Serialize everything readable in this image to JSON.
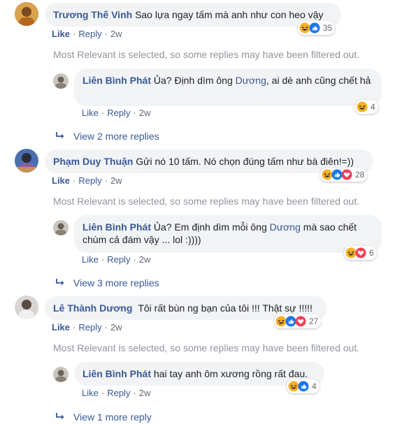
{
  "comments": [
    {
      "author": "Trương Thế Vinh",
      "text": "Sao lựa ngay tấm mà anh như con heo vậy",
      "actions": {
        "like": "Like",
        "reply": "Reply",
        "time": "2w"
      },
      "reaction_count": "35",
      "filter_note": "Most Relevant is selected, so some replies may have been filtered out.",
      "reply": {
        "author": "Liên Bình Phát",
        "text_before": "Ủa? Định dìm ông ",
        "mention": "Dương",
        "text_after": ", ai dè anh cũng chết hả",
        "actions": {
          "like": "Like",
          "reply": "Reply",
          "time": "2w"
        },
        "reaction_count": "4"
      },
      "view_more": "View 2 more replies"
    },
    {
      "author": "Phạm Duy Thuận",
      "text": "Gửi nó 10 tấm. Nó chọn đúng tấm như bà điên!=))",
      "actions": {
        "like": "Like",
        "reply": "Reply",
        "time": "2w"
      },
      "reaction_count": "28",
      "filter_note": "Most Relevant is selected, so some replies may have been filtered out.",
      "reply": {
        "author": "Liên Bình Phát",
        "text_before": "Ủa? Em định dìm mỗi ông ",
        "mention": "Dương",
        "text_after": " mà sao chết chùm cả đám vậy ... lol :))))",
        "actions": {
          "like": "Like",
          "reply": "Reply",
          "time": "2w"
        },
        "reaction_count": "6"
      },
      "view_more": "View 3 more replies"
    },
    {
      "author": "Lê Thành Dương",
      "text": "Tôi rất bùn ng bạn của tôi !!! Thật sự !!!!!",
      "actions": {
        "like": "Like",
        "reply": "Reply",
        "time": "2w"
      },
      "reaction_count": "27",
      "filter_note": "Most Relevant is selected, so some replies may have been filtered out.",
      "reply": {
        "author": "Liên Bình Phát",
        "text_before": "hai tay anh ôm xương rồng rất đau.",
        "mention": "",
        "text_after": "",
        "actions": {
          "like": "Like",
          "reply": "Reply",
          "time": "2w"
        },
        "reaction_count": "4"
      },
      "view_more": "View 1 more reply"
    }
  ],
  "colors": {
    "link": "#385898",
    "bubble": "#f2f3f5",
    "muted": "#90949c",
    "haha": "#f7b125",
    "like": "#1877f2",
    "love": "#f33e58"
  },
  "icons": {
    "reaction_haha": "haha-emoji-icon",
    "reaction_like": "like-thumb-icon",
    "reaction_love": "love-heart-icon",
    "view_more": "reply-arrow-icon"
  }
}
